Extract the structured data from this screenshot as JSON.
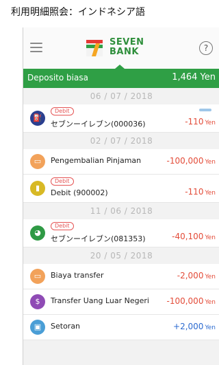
{
  "caption": "利用明細照会：インドネシア語",
  "brand": {
    "line1": "SEVEN",
    "line2": "BANK"
  },
  "account": {
    "name": "Deposito biasa",
    "balance": "1,464 Yen"
  },
  "help_symbol": "?",
  "transactions": [
    {
      "date": "06 / 07 / 2018"
    },
    {
      "badge": "Debit",
      "title": "セブンーイレブン(000036)",
      "amount": "-110",
      "unit": "Yen",
      "sign": "neg",
      "icon": "blue",
      "icon_glyph": "⛽"
    },
    {
      "date": "02 / 07 / 2018"
    },
    {
      "title": "Pengembalian Pinjaman",
      "amount": "-100,000",
      "unit": "Yen",
      "sign": "neg",
      "icon": "orange",
      "icon_glyph": "▭"
    },
    {
      "badge": "Debit",
      "title": "Debit (900002)",
      "amount": "-110",
      "unit": "Yen",
      "sign": "neg",
      "icon": "yellow",
      "icon_glyph": "▮"
    },
    {
      "date": "11 / 06 / 2018"
    },
    {
      "badge": "Debit",
      "title": "セブンーイレブン(081353)",
      "amount": "-40,100",
      "unit": "Yen",
      "sign": "neg",
      "icon": "green",
      "icon_glyph": "◕"
    },
    {
      "date": "20 / 05 / 2018"
    },
    {
      "title": "Biaya transfer",
      "amount": "-2,000",
      "unit": "Yen",
      "sign": "neg",
      "icon": "orange",
      "icon_glyph": "▭"
    },
    {
      "title": "Transfer Uang Luar Negeri",
      "amount": "-100,000",
      "unit": "Yen",
      "sign": "neg",
      "icon": "purple",
      "icon_glyph": "$"
    },
    {
      "title": "Setoran",
      "amount": "+2,000",
      "unit": "Yen",
      "sign": "pos",
      "icon": "lightblue",
      "icon_glyph": "▣"
    }
  ]
}
